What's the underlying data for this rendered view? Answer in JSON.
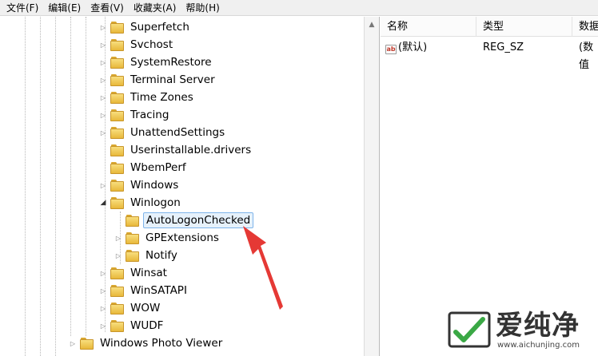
{
  "menubar": [
    "文件(F)",
    "编辑(E)",
    "查看(V)",
    "收藏夹(A)",
    "帮助(H)"
  ],
  "tree": {
    "items": [
      {
        "label": "Superfetch",
        "state": "collapsed"
      },
      {
        "label": "Svchost",
        "state": "collapsed"
      },
      {
        "label": "SystemRestore",
        "state": "collapsed"
      },
      {
        "label": "Terminal Server",
        "state": "collapsed"
      },
      {
        "label": "Time Zones",
        "state": "collapsed"
      },
      {
        "label": "Tracing",
        "state": "collapsed"
      },
      {
        "label": "UnattendSettings",
        "state": "collapsed"
      },
      {
        "label": "Userinstallable.drivers",
        "state": "leaf"
      },
      {
        "label": "WbemPerf",
        "state": "leaf"
      },
      {
        "label": "Windows",
        "state": "collapsed"
      },
      {
        "label": "Winlogon",
        "state": "expanded"
      },
      {
        "label": "AutoLogonChecked",
        "state": "leaf",
        "selected": true
      },
      {
        "label": "GPExtensions",
        "state": "collapsed"
      },
      {
        "label": "Notify",
        "state": "collapsed"
      },
      {
        "label": "Winsat",
        "state": "collapsed"
      },
      {
        "label": "WinSATAPI",
        "state": "collapsed"
      },
      {
        "label": "WOW",
        "state": "collapsed"
      },
      {
        "label": "WUDF",
        "state": "collapsed"
      },
      {
        "label": "Windows Photo Viewer",
        "state": "collapsed"
      }
    ]
  },
  "values_pane": {
    "headers": [
      "名称",
      "类型",
      "数据"
    ],
    "rows": [
      {
        "icon": "string-value-icon",
        "name": "(默认)",
        "type": "REG_SZ",
        "data": "(数值"
      }
    ]
  },
  "watermark": {
    "brand": "爱纯净",
    "url": "www.aichunjing.com"
  },
  "colors": {
    "arrow": "#e53935",
    "selection_border": "#7eb4ea",
    "watermark_green": "#3aa845"
  }
}
